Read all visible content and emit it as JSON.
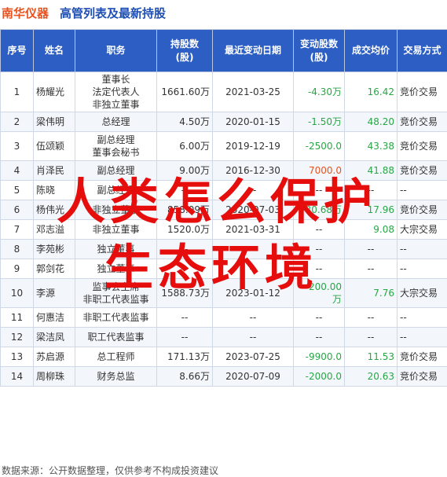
{
  "header": {
    "company": "南华仪器",
    "title": "高管列表及最新持股"
  },
  "columns": [
    "序号",
    "姓名",
    "职务",
    "持股数\n(股)",
    "最近变动日期",
    "变动股数\n(股)",
    "成交均价",
    "交易方式"
  ],
  "rows": [
    {
      "no": "1",
      "name": "杨耀光",
      "position": "董事长\n法定代表人\n非独立董事",
      "shares": "1661.60万",
      "date": "2021-03-25",
      "change": "-4.30万",
      "price": "16.42",
      "method": "竞价交易"
    },
    {
      "no": "2",
      "name": "梁伟明",
      "position": "总经理",
      "shares": "4.50万",
      "date": "2020-01-15",
      "change": "-1.50万",
      "price": "48.20",
      "method": "竞价交易"
    },
    {
      "no": "3",
      "name": "伍颂颖",
      "position": "副总经理\n董事会秘书",
      "shares": "6.00万",
      "date": "2019-12-19",
      "change": "-2500.0",
      "price": "43.38",
      "method": "竞价交易"
    },
    {
      "no": "4",
      "name": "肖泽民",
      "position": "副总经理",
      "shares": "9.00万",
      "date": "2016-12-30",
      "change": "7000.0",
      "price": "41.88",
      "method": "竞价交易"
    },
    {
      "no": "5",
      "name": "陈晓",
      "position": "副总经理",
      "shares": "--",
      "date": "--",
      "change": "--",
      "price": "--",
      "method": "--"
    },
    {
      "no": "6",
      "name": "杨伟光",
      "position": "非独立董事",
      "shares": "858.09万",
      "date": "2020-07-03",
      "change": "-30.68万",
      "price": "17.96",
      "method": "竞价交易"
    },
    {
      "no": "7",
      "name": "邓志溢",
      "position": "非独立董事",
      "shares": "1520.0万",
      "date": "2021-03-31",
      "change": "--",
      "price": "9.08",
      "method": "大宗交易"
    },
    {
      "no": "8",
      "name": "李苑彬",
      "position": "独立董事",
      "shares": "--",
      "date": "--",
      "change": "--",
      "price": "--",
      "method": "--"
    },
    {
      "no": "9",
      "name": "郭剑花",
      "position": "独立董事",
      "shares": "--",
      "date": "--",
      "change": "--",
      "price": "--",
      "method": "--"
    },
    {
      "no": "10",
      "name": "李源",
      "position": "监事会主席\n非职工代表监事",
      "shares": "1588.73万",
      "date": "2023-01-12",
      "change": "-200.00万",
      "price": "7.76",
      "method": "大宗交易"
    },
    {
      "no": "11",
      "name": "何惠洁",
      "position": "非职工代表监事",
      "shares": "--",
      "date": "--",
      "change": "--",
      "price": "--",
      "method": "--"
    },
    {
      "no": "12",
      "name": "梁洁凤",
      "position": "职工代表监事",
      "shares": "--",
      "date": "--",
      "change": "--",
      "price": "--",
      "method": "--"
    },
    {
      "no": "13",
      "name": "苏启源",
      "position": "总工程师",
      "shares": "171.13万",
      "date": "2023-07-25",
      "change": "-9900.0",
      "price": "11.53",
      "method": "竞价交易"
    },
    {
      "no": "14",
      "name": "周柳珠",
      "position": "财务总监",
      "shares": "8.66万",
      "date": "2020-07-09",
      "change": "-2000.0",
      "price": "20.63",
      "method": "竞价交易"
    }
  ],
  "footer": "数据来源：公开数据整理，仅供参考不构成投资建议",
  "overlay": {
    "line1": "人类怎么保护",
    "line2": "生态环境"
  },
  "colors": {
    "header_bg": "#2c5ec4",
    "company": "#e8521e",
    "title": "#1f4fb4",
    "overlay": "#e60d0d",
    "negative": "#28a745",
    "positive": "#e8521e"
  }
}
